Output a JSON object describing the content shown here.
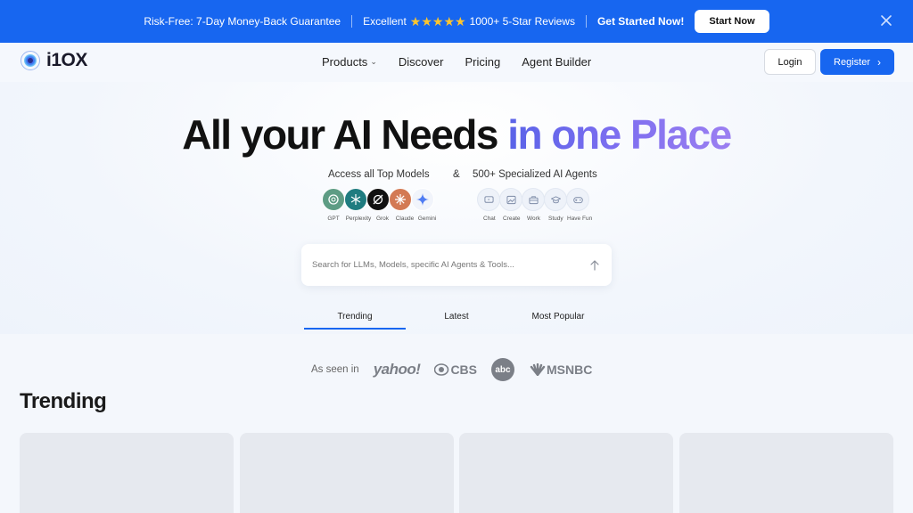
{
  "promo": {
    "guarantee": "Risk-Free: 7-Day Money-Back Guarantee",
    "excellent": "Excellent",
    "stars": "★★★★★",
    "reviews": "1000+ 5-Star Reviews",
    "cta_text": "Get Started Now!",
    "start_button": "Start Now"
  },
  "brand": {
    "name": "i1OX"
  },
  "nav": {
    "items": [
      "Products",
      "Discover",
      "Pricing",
      "Agent Builder"
    ],
    "login": "Login",
    "register": "Register"
  },
  "hero": {
    "headline_plain": "All your AI Needs",
    "headline_accent": "in one Place",
    "models_caption": "Access all Top Models",
    "amp": "&",
    "agents_caption": "500+ Specialized AI Agents",
    "models": [
      "GPT",
      "Perplexity",
      "Grok",
      "Claude",
      "Gemini"
    ],
    "agents": [
      "Chat",
      "Create",
      "Work",
      "Study",
      "Have Fun"
    ]
  },
  "search": {
    "placeholder": "Search for LLMs, Models, specific AI Agents & Tools..."
  },
  "tabs": [
    "Trending",
    "Latest",
    "Most Popular"
  ],
  "press": {
    "label": "As seen in",
    "outlets": [
      "yahoo!",
      "CBS",
      "abc",
      "MSNBC"
    ]
  },
  "section": {
    "title": "Trending"
  },
  "colors": {
    "primary": "#1766f0",
    "accent_gradient_start": "#5a63e8",
    "accent_gradient_end": "#9b7ff1"
  }
}
